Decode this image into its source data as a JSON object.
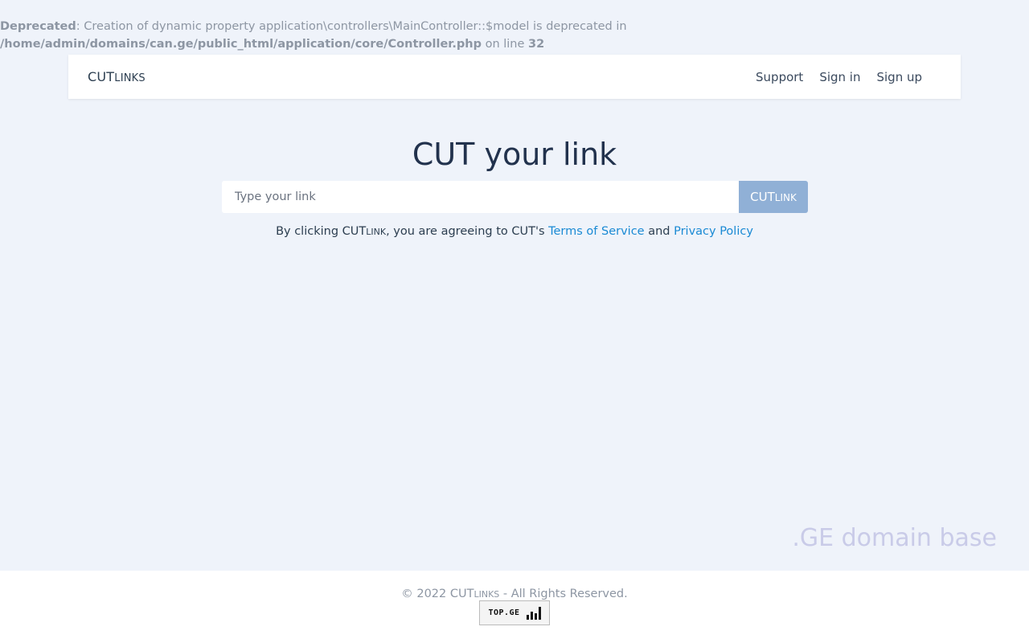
{
  "notice": {
    "label": "Deprecated",
    "message": ": Creation of dynamic property application\\controllers\\MainController::$model is deprecated in ",
    "file": "/home/admin/domains/can.ge/public_html/application/core/Controller.php",
    "on_line": " on line ",
    "line": "32"
  },
  "navbar": {
    "brand_main": "CUT",
    "brand_small": "LINKS",
    "links": [
      "Support",
      "Sign in",
      "Sign up"
    ]
  },
  "hero": {
    "title": "CUT your link",
    "input_placeholder": "Type your link",
    "button_main": "CUT",
    "button_small": "LINK"
  },
  "terms": {
    "prefix": "By clicking CUT",
    "small": "LINK",
    "middle": ", you are agreeing to CUT's ",
    "tos": "Terms of Service",
    "and": " and ",
    "privacy": "Privacy Policy"
  },
  "watermark": ".GE domain base",
  "footer": {
    "copyright_prefix": "© 2022 CUT",
    "copyright_small": "LINKS",
    "copyright_suffix": " - All Rights Reserved.",
    "badge_label": "TOP.GE",
    "badge_icon": "bar-chart-icon"
  },
  "colors": {
    "background": "#eff3fa",
    "button": "#90b0d6",
    "link": "#1a8ad4",
    "watermark": "#c9cbe8"
  }
}
